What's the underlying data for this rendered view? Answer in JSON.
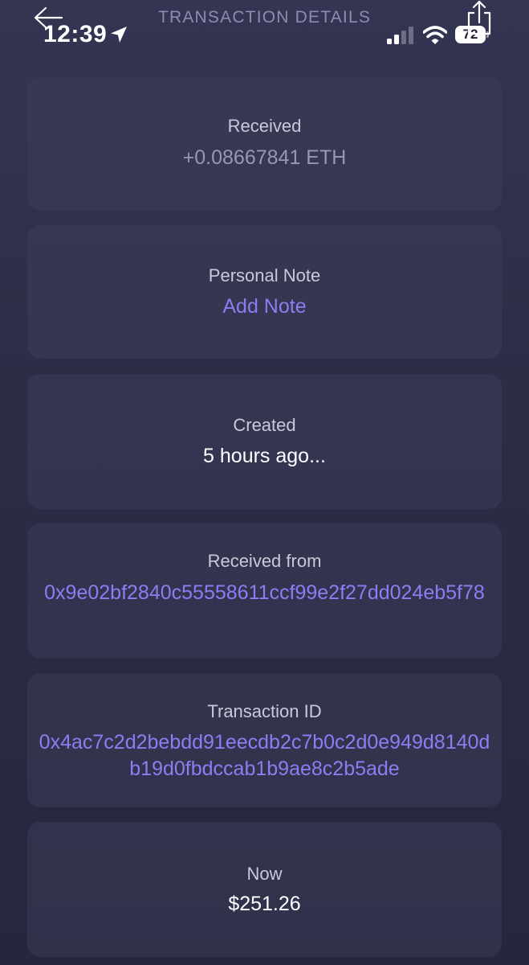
{
  "status_bar": {
    "time": "12:39",
    "battery": "72"
  },
  "header": {
    "title": "TRANSACTION DETAILS"
  },
  "cards": [
    {
      "label": "Received",
      "value": "+0.08667841 ETH"
    },
    {
      "label": "Personal Note",
      "value": "Add Note"
    },
    {
      "label": "Created",
      "value": "5 hours ago..."
    },
    {
      "label": "Received from",
      "value": "0x9e02bf2840c55558611ccf99e2f27dd024eb5f78"
    },
    {
      "label": "Transaction ID",
      "value": "0x4ac7c2d2bebdd91eecdb2c7b0c2d0e949d8140db19d0fbdccab1b9ae8c2b5ade"
    },
    {
      "label": "Now",
      "value": "$251.26"
    }
  ],
  "colors": {
    "accent": "#8f7cf2",
    "background": "#2c2e48",
    "card": "#3a3c5a"
  },
  "icons": [
    "location-arrow-icon",
    "cellular-signal-icon",
    "wifi-icon",
    "battery-icon",
    "back-arrow-icon",
    "share-icon"
  ]
}
